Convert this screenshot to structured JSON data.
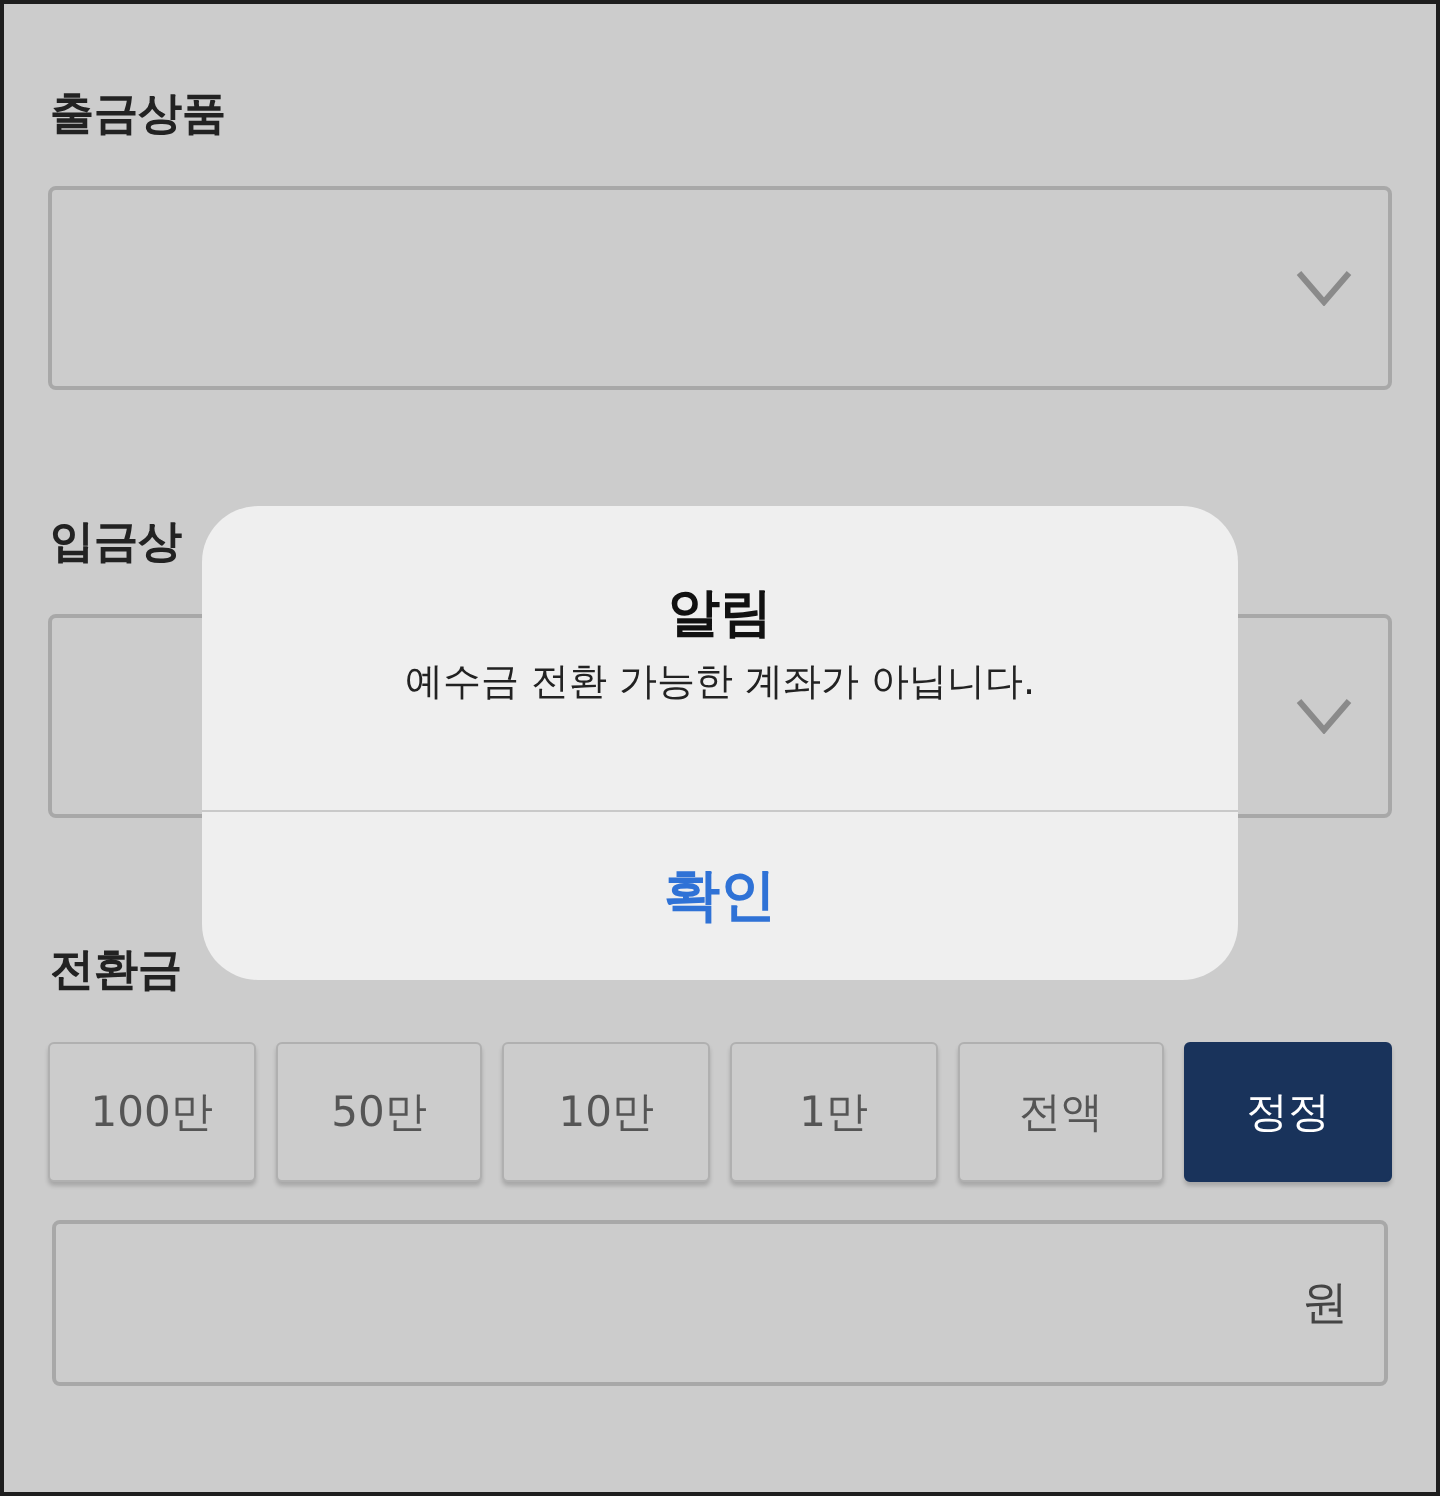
{
  "selects": [
    {
      "label": "출금상품"
    },
    {
      "label": "입금상"
    }
  ],
  "amount": {
    "label": "전환금",
    "quick_buttons": [
      {
        "label": "100만",
        "selected": false
      },
      {
        "label": "50만",
        "selected": false
      },
      {
        "label": "10만",
        "selected": false
      },
      {
        "label": "1만",
        "selected": false
      },
      {
        "label": "전액",
        "selected": false
      },
      {
        "label": "정정",
        "selected": true
      }
    ],
    "unit": "원"
  },
  "dialog": {
    "title": "알림",
    "message": "예수금 전환 가능한 계좌가 아닙니다.",
    "buttons": [
      "확인"
    ]
  }
}
